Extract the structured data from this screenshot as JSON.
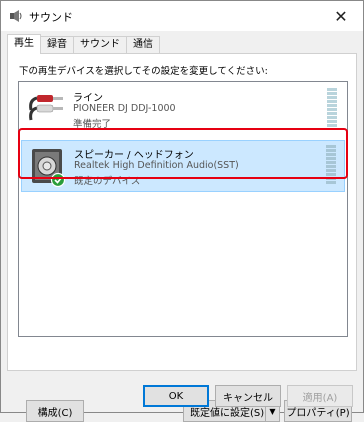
{
  "window": {
    "title": "サウンド",
    "close_glyph": "✕"
  },
  "tabs": [
    {
      "label": "再生",
      "active": true
    },
    {
      "label": "録音",
      "active": false
    },
    {
      "label": "サウンド",
      "active": false
    },
    {
      "label": "通信",
      "active": false
    }
  ],
  "panel": {
    "instruction": "下の再生デバイスを選択してその設定を変更してください:"
  },
  "devices": [
    {
      "name": "ライン",
      "sub": "PIONEER DJ DDJ-1000",
      "status": "準備完了",
      "icon": "rca-cable-icon",
      "selected": false
    },
    {
      "name": "スピーカー / ヘッドフォン",
      "sub": "Realtek High Definition Audio(SST)",
      "status": "既定のデバイス",
      "icon": "speaker-icon",
      "selected": true,
      "default_badge": "check-badge-icon"
    }
  ],
  "buttons": {
    "configure": "構成(C)",
    "set_default": "既定値に設定(S)",
    "properties": "プロパティ(P)",
    "ok": "OK",
    "cancel": "キャンセル",
    "apply": "適用(A)"
  },
  "colors": {
    "selection": "#cce8ff",
    "highlight": "#e60012",
    "check": "#2a9d3a"
  }
}
